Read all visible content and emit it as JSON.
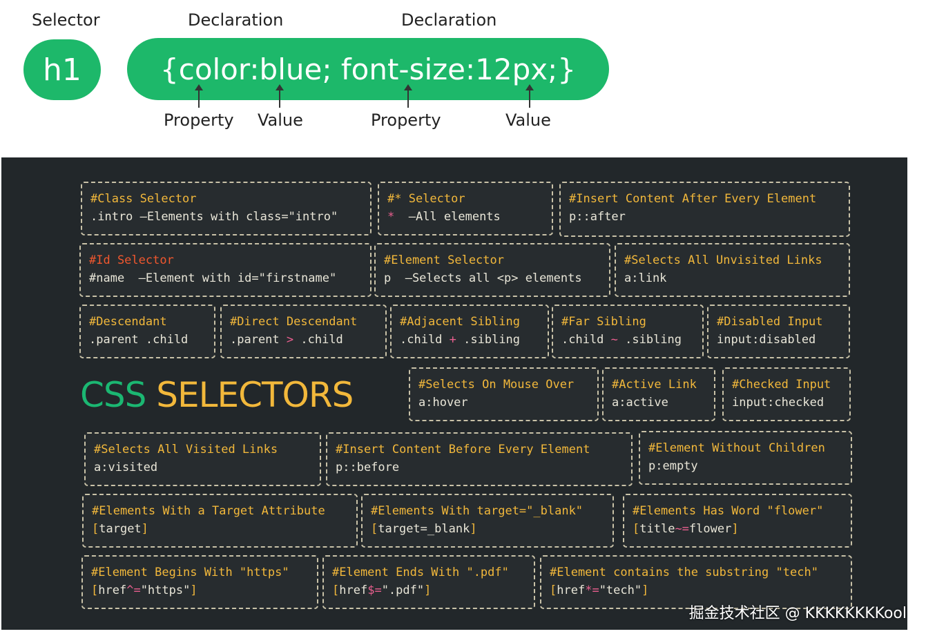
{
  "diagram": {
    "selector_label": "Selector",
    "declaration_label_1": "Declaration",
    "declaration_label_2": "Declaration",
    "selector": "h1",
    "declaration": "{color:blue; font-size:12px;}",
    "property_label_1": "Property",
    "value_label_1": "Value",
    "property_label_2": "Property",
    "value_label_2": "Value",
    "accent_color": "#1db86a"
  },
  "cheatsheet": {
    "title_part1": "CSS",
    "title_part2": "SELECTORS",
    "colors": {
      "background": "#22272a",
      "title_green": "#1bb772",
      "heading_yellow": "#f2b83b",
      "heading_red": "#f0572e",
      "code_text": "#e9e6d8",
      "symbol_pink": "#ea5f8f"
    },
    "cards": [
      {
        "title": "#Class Selector",
        "code": ".intro –Elements with class=\"intro\""
      },
      {
        "title": "#* Selector",
        "code_sym": "*",
        "code": "  –All elements"
      },
      {
        "title": "#Insert Content After Every Element",
        "code": "p::after"
      },
      {
        "title": "#Id Selector",
        "code": "#name  –Element with id=\"firstname\""
      },
      {
        "title": "#Element Selector",
        "code": "p  –Selects all <p> elements"
      },
      {
        "title": "#Selects All Unvisited Links",
        "code": "a:link"
      },
      {
        "title": "#Descendant",
        "code": ".parent .child"
      },
      {
        "title": "#Direct Descendant",
        "code_a": ".parent ",
        "code_sym": ">",
        "code_b": " .child"
      },
      {
        "title": "#Adjacent Sibling",
        "code_a": ".child ",
        "code_sym": "+",
        "code_b": " .sibling"
      },
      {
        "title": "#Far Sibling",
        "code_a": ".child ",
        "code_sym": "~",
        "code_b": " .sibling"
      },
      {
        "title": "#Disabled Input",
        "code": "input:disabled"
      },
      {
        "title": "#Selects On Mouse Over",
        "code": "a:hover"
      },
      {
        "title": "#Active Link",
        "code": "a:active"
      },
      {
        "title": "#Checked Input",
        "code": "input:checked"
      },
      {
        "title": "#Selects All Visited Links",
        "code": "a:visited"
      },
      {
        "title": "#Insert Content Before Every Element",
        "code": "p::before"
      },
      {
        "title": "#Element Without Children",
        "code": "p:empty"
      },
      {
        "title": "#Elements With a Target Attribute",
        "code_a": "[",
        "code_b": "target",
        "code_c": "]"
      },
      {
        "title": "#Elements With target=\"_blank\"",
        "code_a": "[",
        "code_b": "target=_blank",
        "code_c": "]"
      },
      {
        "title": "#Elements Has Word \"flower\"",
        "code_a": "[",
        "code_b": "title",
        "code_sym": "~=",
        "code_d": "flower",
        "code_c": "]"
      },
      {
        "title": "#Element Begins With \"https\"",
        "code_a": "[",
        "code_b": "href",
        "code_sym": "^=",
        "code_d": "\"https\"",
        "code_c": "]"
      },
      {
        "title": "#Element Ends With \".pdf\"",
        "code_a": "[",
        "code_b": "href",
        "code_sym": "$=",
        "code_d": "\".pdf\"",
        "code_c": "]"
      },
      {
        "title": "#Element contains the substring \"tech\"",
        "code_a": "[",
        "code_b": "href",
        "code_sym": "*=",
        "code_d": "\"tech\"",
        "code_c": "]"
      }
    ]
  },
  "watermark": "掘金技术社区 @ KKKKKKKKool"
}
